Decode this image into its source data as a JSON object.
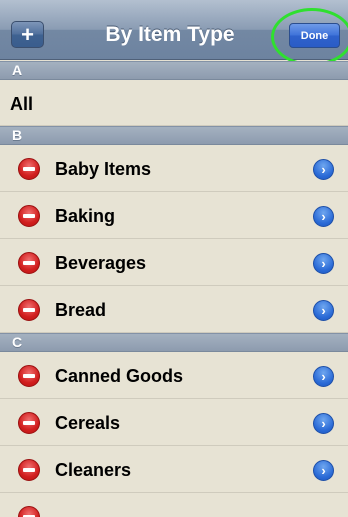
{
  "navbar": {
    "title": "By Item Type",
    "add_label": "+",
    "done_label": "Done"
  },
  "sections": [
    {
      "header": "A",
      "items": [
        {
          "label": "All"
        }
      ]
    },
    {
      "header": "B",
      "items": [
        {
          "label": "Baby Items"
        },
        {
          "label": "Baking"
        },
        {
          "label": "Beverages"
        },
        {
          "label": "Bread"
        }
      ]
    },
    {
      "header": "C",
      "items": [
        {
          "label": "Canned Goods"
        },
        {
          "label": "Cereals"
        },
        {
          "label": "Cleaners"
        }
      ]
    }
  ],
  "icons": {
    "delete": "minus-circle-icon",
    "disclosure": "chevron-right-icon"
  },
  "colors": {
    "done_highlight": "#2fe02f",
    "delete_red": "#d11e1e",
    "disclosure_blue": "#2a6ad6"
  }
}
